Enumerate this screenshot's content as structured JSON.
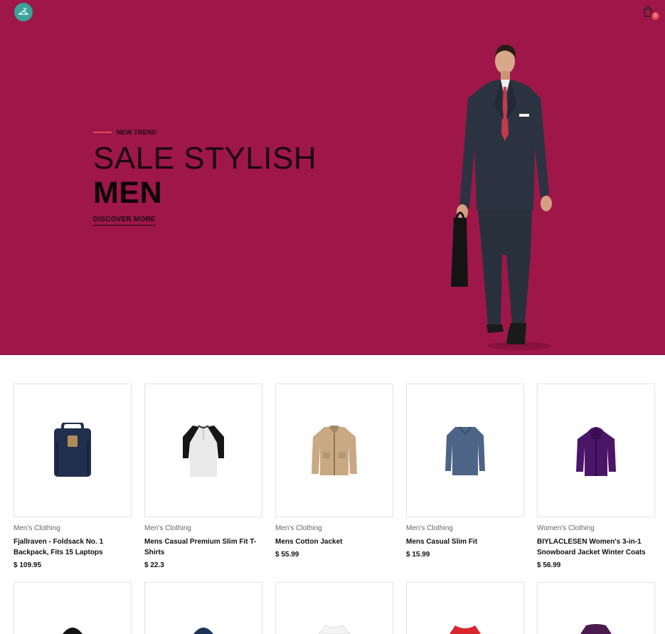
{
  "header": {
    "logo_icon": "hanger-icon",
    "cart_icon": "shopping-bag-icon",
    "cart_count": "0"
  },
  "hero": {
    "eyebrow": "NEW TREND",
    "title_light": "SALE STYLISH",
    "title_bold": "MEN",
    "cta": "DISCOVER MORE",
    "background_color": "#9e1748",
    "accent_color": "#e44b5a"
  },
  "products": [
    {
      "category": "Men's Clothing",
      "title": "Fjallraven - Foldsack No. 1 Backpack, Fits 15 Laptops",
      "price": "$ 109.95",
      "image": "backpack"
    },
    {
      "category": "Men's Clothing",
      "title": "Mens Casual Premium Slim Fit T-Shirts",
      "price": "$ 22.3",
      "image": "raglan-tshirt"
    },
    {
      "category": "Men's Clothing",
      "title": "Mens Cotton Jacket",
      "price": "$ 55.99",
      "image": "cotton-jacket"
    },
    {
      "category": "Men's Clothing",
      "title": "Mens Casual Slim Fit",
      "price": "$ 15.99",
      "image": "slim-fit-shirt"
    },
    {
      "category": "Women's Clothing",
      "title": "BIYLACLESEN Women's 3-in-1 Snowboard Jacket Winter Coats",
      "price": "$ 56.99",
      "image": "snowboard-jacket"
    }
  ]
}
